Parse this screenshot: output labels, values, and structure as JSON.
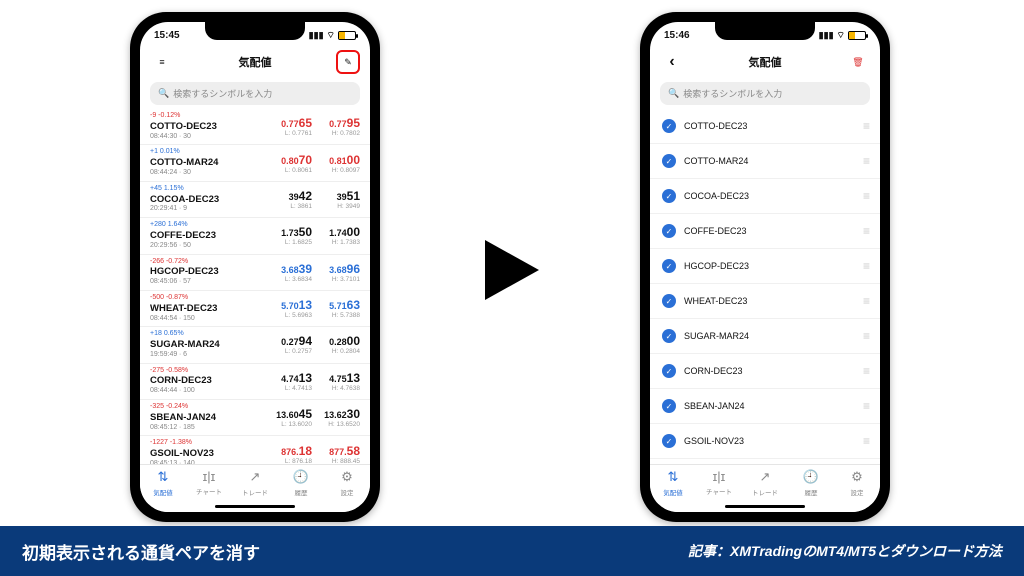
{
  "status": {
    "time_left": "15:45",
    "time_right": "15:46"
  },
  "nav": {
    "title": "気配値",
    "back": "‹",
    "menu": "≡",
    "pencil": "✎",
    "trash": "🗑"
  },
  "search": {
    "placeholder": "検索するシンボルを入力",
    "icon": "🔍"
  },
  "rows": [
    {
      "chg": "-9 -0.12%",
      "dir": "dn",
      "sym": "COTTO-DEC23",
      "ts": "08:44:30 ∙ 30",
      "bid": "0.7765",
      "ask": "0.7795",
      "lo": "L: 0.7761",
      "hi": "H: 0.7802",
      "bdir": "dn",
      "adir": "dn"
    },
    {
      "chg": "+1 0.01%",
      "dir": "up",
      "sym": "COTTO-MAR24",
      "ts": "08:44:24 ∙ 30",
      "bid": "0.8070",
      "ask": "0.8100",
      "lo": "L: 0.8061",
      "hi": "H: 0.8097",
      "bdir": "dn",
      "adir": "dn"
    },
    {
      "chg": "+45 1.15%",
      "dir": "up",
      "sym": "COCOA-DEC23",
      "ts": "20:29:41 ∙ 9",
      "bid": "3942",
      "ask": "3951",
      "lo": "L: 3861",
      "hi": "H: 3949",
      "bdir": "",
      "adir": ""
    },
    {
      "chg": "+280 1.64%",
      "dir": "up",
      "sym": "COFFE-DEC23",
      "ts": "20:29:56 ∙ 50",
      "bid": "1.7350",
      "ask": "1.7400",
      "lo": "L: 1.6825",
      "hi": "H: 1.7383",
      "bdir": "",
      "adir": ""
    },
    {
      "chg": "-266 -0.72%",
      "dir": "dn",
      "sym": "HGCOP-DEC23",
      "ts": "08:45:06 ∙ 57",
      "bid": "3.6839",
      "ask": "3.6896",
      "lo": "L: 3.6834",
      "hi": "H: 3.7101",
      "bdir": "up",
      "adir": "up"
    },
    {
      "chg": "-500 -0.87%",
      "dir": "dn",
      "sym": "WHEAT-DEC23",
      "ts": "08:44:54 ∙ 150",
      "bid": "5.7013",
      "ask": "5.7163",
      "lo": "L: 5.6963",
      "hi": "H: 5.7388",
      "bdir": "up",
      "adir": "up"
    },
    {
      "chg": "+18 0.65%",
      "dir": "up",
      "sym": "SUGAR-MAR24",
      "ts": "19:59:49 ∙ 6",
      "bid": "0.2794",
      "ask": "0.2800",
      "lo": "L: 0.2757",
      "hi": "H: 0.2804",
      "bdir": "",
      "adir": ""
    },
    {
      "chg": "-275 -0.58%",
      "dir": "dn",
      "sym": "CORN-DEC23",
      "ts": "08:44:44 ∙ 100",
      "bid": "4.7413",
      "ask": "4.7513",
      "lo": "L: 4.7413",
      "hi": "H: 4.7638",
      "bdir": "",
      "adir": ""
    },
    {
      "chg": "-325 -0.24%",
      "dir": "dn",
      "sym": "SBEAN-JAN24",
      "ts": "08:45:12 ∙ 185",
      "bid": "13.6045",
      "ask": "13.6230",
      "lo": "L: 13.6020",
      "hi": "H: 13.6520",
      "bdir": "",
      "adir": ""
    },
    {
      "chg": "-1227 -1.38%",
      "dir": "dn",
      "sym": "GSOIL-NOV23",
      "ts": "08:45:13 ∙ 140",
      "bid": "876.18",
      "ask": "877.58",
      "lo": "L: 876.18",
      "hi": "H: 888.45",
      "bdir": "dn",
      "adir": "dn"
    }
  ],
  "edit_rows": [
    "COTTO-DEC23",
    "COTTO-MAR24",
    "COCOA-DEC23",
    "COFFE-DEC23",
    "HGCOP-DEC23",
    "WHEAT-DEC23",
    "SUGAR-MAR24",
    "CORN-DEC23",
    "SBEAN-JAN24",
    "GSOIL-NOV23"
  ],
  "tabs": [
    {
      "icon": "⇅",
      "label": "気配値",
      "active": true
    },
    {
      "icon": "ɪ|ɪ",
      "label": "チャート"
    },
    {
      "icon": "↗",
      "label": "トレード"
    },
    {
      "icon": "🕘",
      "label": "履歴"
    },
    {
      "icon": "⚙",
      "label": "設定"
    }
  ],
  "banner": {
    "left": "初期表示される通貨ペアを消す",
    "right": "記事：XMTradingのMT4/MT5とダウンロード方法"
  },
  "colors": {
    "accent": "#2a6fd6",
    "danger": "#d33",
    "banner": "#0a3a7a",
    "highlight": "#e11"
  }
}
